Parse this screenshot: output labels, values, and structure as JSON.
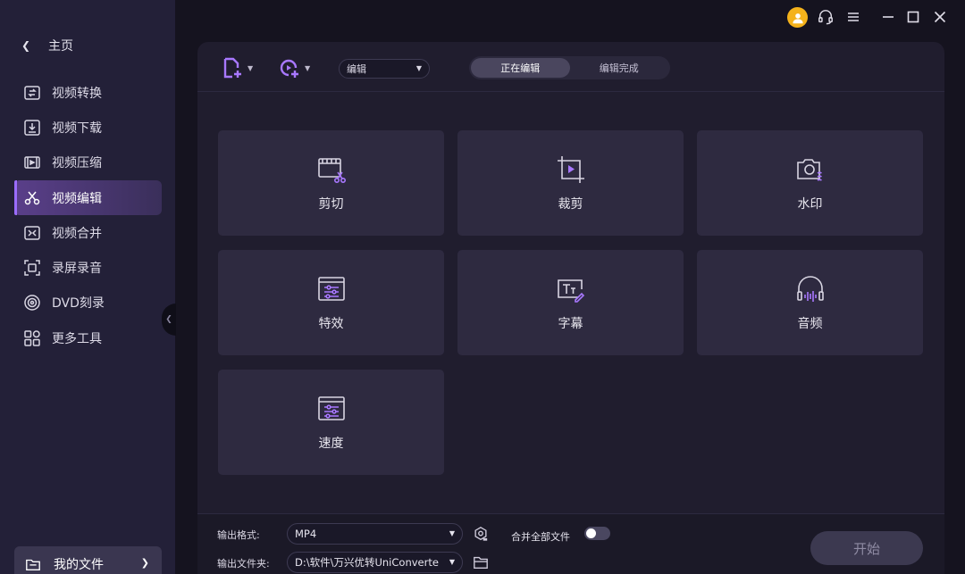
{
  "sidebar": {
    "home_label": "主页",
    "items": [
      {
        "label": "视频转换",
        "icon": "video-convert-icon"
      },
      {
        "label": "视频下载",
        "icon": "download-icon"
      },
      {
        "label": "视频压缩",
        "icon": "compress-icon"
      },
      {
        "label": "视频编辑",
        "icon": "scissors-icon",
        "active": true
      },
      {
        "label": "视频合并",
        "icon": "merge-icon"
      },
      {
        "label": "录屏录音",
        "icon": "screen-record-icon"
      },
      {
        "label": "DVD刻录",
        "icon": "disc-icon"
      },
      {
        "label": "更多工具",
        "icon": "grid-icon"
      }
    ],
    "my_files_label": "我的文件"
  },
  "toolbar": {
    "mode_select_value": "编辑",
    "tabs": [
      "正在编辑",
      "编辑完成"
    ],
    "active_tab": "正在编辑"
  },
  "tools": [
    {
      "label": "剪切",
      "icon": "cut-icon"
    },
    {
      "label": "裁剪",
      "icon": "crop-icon"
    },
    {
      "label": "水印",
      "icon": "watermark-icon"
    },
    {
      "label": "特效",
      "icon": "effects-icon"
    },
    {
      "label": "字幕",
      "icon": "subtitle-icon"
    },
    {
      "label": "音频",
      "icon": "audio-icon"
    },
    {
      "label": "速度",
      "icon": "speed-icon"
    }
  ],
  "bottom": {
    "output_format_label": "输出格式:",
    "output_format_value": "MP4",
    "output_folder_label": "输出文件夹:",
    "output_folder_value": "D:\\软件\\万兴优转UniConverte",
    "merge_all_label": "合并全部文件",
    "start_label": "开始"
  },
  "colors": {
    "accent": "#9b6cff",
    "avatar": "#f4b21b",
    "sidebar_bg": "#232038",
    "panel_bg": "#201d2e",
    "card_bg": "#2e2a40"
  }
}
